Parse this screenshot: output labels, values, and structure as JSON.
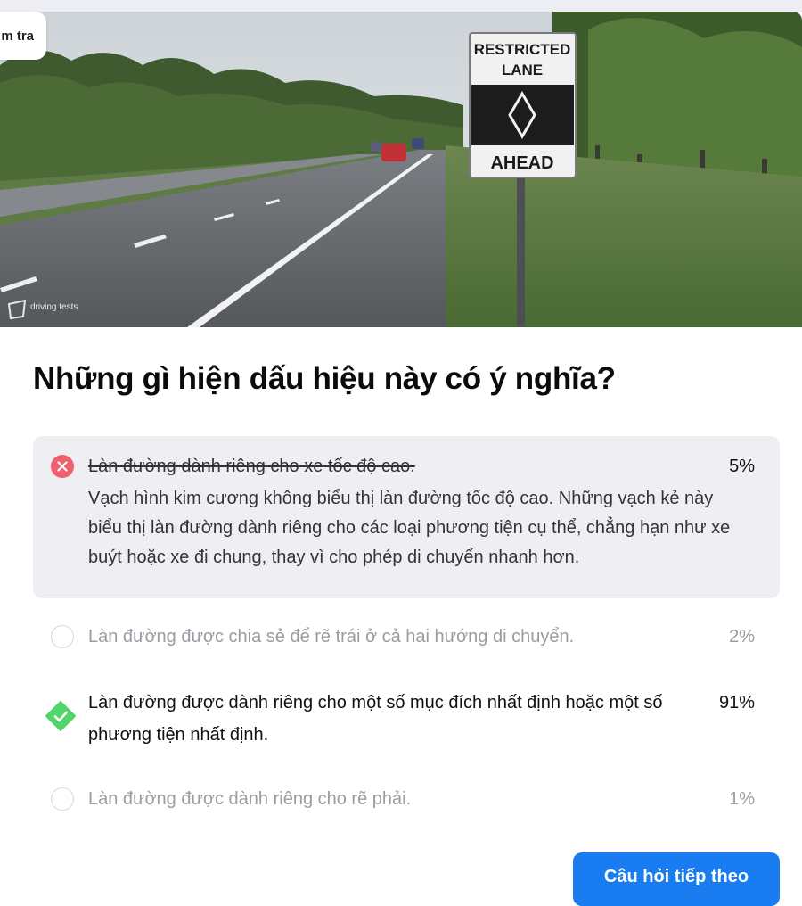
{
  "tag_label": "m tra",
  "sign": {
    "line1": "RESTRICTED",
    "line2": "LANE",
    "line3": "AHEAD"
  },
  "watermark": "driving tests",
  "question": "Những gì hiện dấu hiệu này có ý nghĩa?",
  "answers": [
    {
      "text": "Làn đường dành riêng cho xe tốc độ cao.",
      "percent": "5%",
      "status": "wrong",
      "explanation": "Vạch hình kim cương không biểu thị làn đường tốc độ cao. Những vạch kẻ này biểu thị làn đường dành riêng cho các loại phương tiện cụ thể, chẳng hạn như xe buýt hoặc xe đi chung, thay vì cho phép di chuyển nhanh hơn."
    },
    {
      "text": "Làn đường được chia sẻ để rẽ trái ở cả hai hướng di chuyển.",
      "percent": "2%",
      "status": "unselected"
    },
    {
      "text": "Làn đường được dành riêng cho một số mục đích nhất định hoặc một số phương tiện nhất định.",
      "percent": "91%",
      "status": "correct"
    },
    {
      "text": "Làn đường được dành riêng cho rẽ phải.",
      "percent": "1%",
      "status": "unselected"
    }
  ],
  "next_button": "Câu hỏi tiếp theo",
  "colors": {
    "accent": "#1a7cf1",
    "wrong": "#f0606e",
    "correct": "#52d56a"
  }
}
